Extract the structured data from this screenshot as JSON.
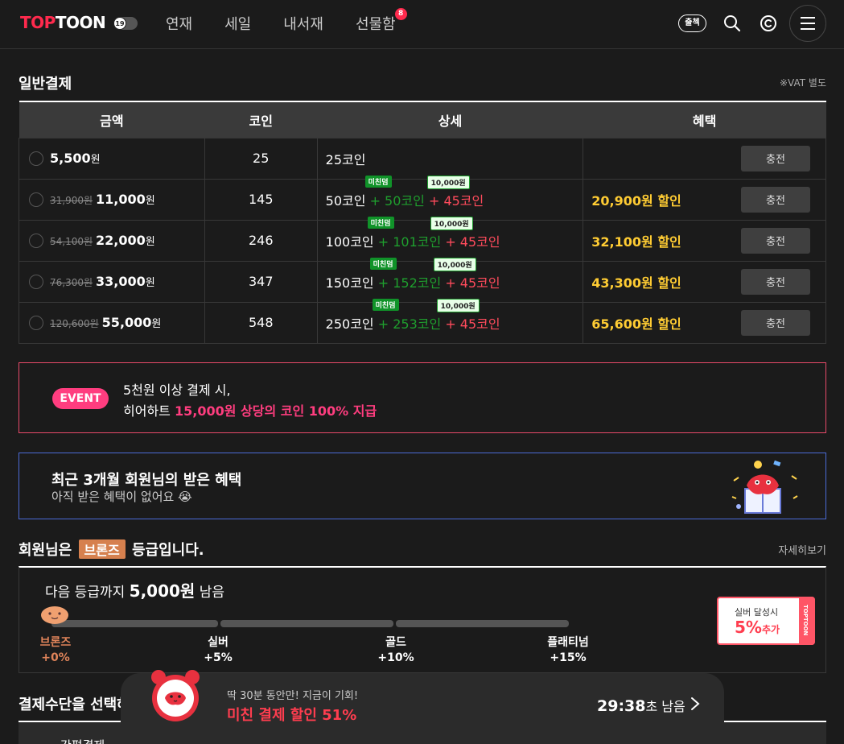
{
  "header": {
    "logo_a": "TOP",
    "logo_b": "TOON",
    "age_badge": "19",
    "nav": [
      {
        "label": "연재"
      },
      {
        "label": "세일"
      },
      {
        "label": "내서재"
      },
      {
        "label": "선물함",
        "badge": "8"
      }
    ],
    "attendance": "출첵",
    "icons": [
      "search-icon",
      "coin-icon",
      "menu-icon"
    ]
  },
  "general": {
    "title": "일반결제",
    "vat": "※VAT 별도",
    "columns": [
      "금액",
      "코인",
      "상세",
      "혜택"
    ],
    "rows": [
      {
        "old": "",
        "price": "5,500",
        "won": "원",
        "coins": "25",
        "base": "25코인",
        "bonus": "",
        "extra": "",
        "tag1": "",
        "tag2": "",
        "benefit": "",
        "button": "충전"
      },
      {
        "old": "31,900원",
        "price": "11,000",
        "won": "원",
        "coins": "145",
        "base": "50코인",
        "bonus": "+ 50코인",
        "extra": "+ 45코인",
        "tag1": "미친덤",
        "tag2": "10,000원",
        "benefit": "20,900원 할인",
        "button": "충전"
      },
      {
        "old": "54,100원",
        "price": "22,000",
        "won": "원",
        "coins": "246",
        "base": "100코인",
        "bonus": "+ 101코인",
        "extra": "+ 45코인",
        "tag1": "미친덤",
        "tag2": "10,000원",
        "benefit": "32,100원 할인",
        "button": "충전"
      },
      {
        "old": "76,300원",
        "price": "33,000",
        "won": "원",
        "coins": "347",
        "base": "150코인",
        "bonus": "+ 152코인",
        "extra": "+ 45코인",
        "tag1": "미친덤",
        "tag2": "10,000원",
        "benefit": "43,300원 할인",
        "button": "충전"
      },
      {
        "old": "120,600원",
        "price": "55,000",
        "won": "원",
        "coins": "548",
        "base": "250코인",
        "bonus": "+ 253코인",
        "extra": "+ 45코인",
        "tag1": "미친덤",
        "tag2": "10,000원",
        "benefit": "65,600원 할인",
        "button": "충전"
      }
    ]
  },
  "event": {
    "badge": "EVENT",
    "line1": "5천원 이상 결제 시,",
    "line2_prefix": "히어하트 ",
    "line2_highlight": "15,000원 상당의 코인 100% 지급"
  },
  "recent": {
    "title": "최근 3개월 회원님의 받은 혜택",
    "subtitle": "아직 받은 혜택이 없어요 😭"
  },
  "grade": {
    "prefix": "회원님은",
    "name": "브론즈",
    "suffix": "등급입니다.",
    "more": "자세히보기",
    "next_prefix": "다음 등급까지",
    "next_amount": "5,000원",
    "next_suffix": "남음",
    "levels": [
      {
        "name": "브론즈",
        "bonus": "+0%"
      },
      {
        "name": "실버",
        "bonus": "+5%"
      },
      {
        "name": "골드",
        "bonus": "+10%"
      },
      {
        "name": "플래티넘",
        "bonus": "+15%"
      }
    ],
    "ticket_line1": "실버 달성시",
    "ticket_pct": "5%",
    "ticket_add": "추가",
    "ticket_brand": "TOPTOON"
  },
  "payment": {
    "title": "결제수단을 선택하",
    "method": "간편결제"
  },
  "timer": {
    "line1": "딱 30분 동안만! 지금이 기회!",
    "line2": "미친 결제 할인 51%",
    "count": "29:38",
    "unit": "초 남음"
  },
  "colors": {
    "brand_red": "#ff2a4d",
    "benefit_yellow": "#ffcc33",
    "bonus_green": "#1f9f2e",
    "event_pink": "#ff3d7f",
    "bronze": "#d6804e"
  }
}
